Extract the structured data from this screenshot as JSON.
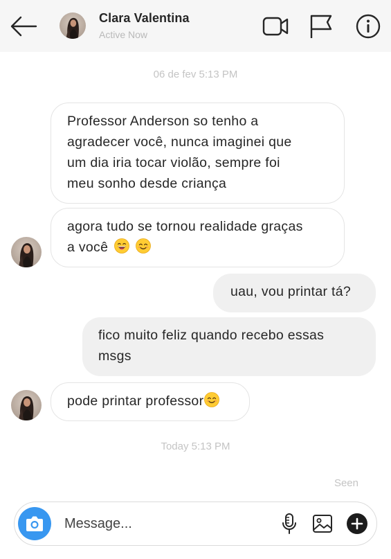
{
  "header": {
    "name": "Clara Valentina",
    "status": "Active Now",
    "icons": [
      "back-arrow-icon",
      "video-camera-icon",
      "flag-icon",
      "info-icon"
    ]
  },
  "messages": {
    "timestamp_1": "06 de fev 5:13 PM",
    "m1_lines": [
      "Professor Anderson so tenho a",
      "agradecer você, nunca imaginei que",
      "um dia iria tocar violão, sempre foi",
      "meu sonho desde criança"
    ],
    "m2_lines": [
      "agora tudo se tornou realidade graças",
      "a você"
    ],
    "m3_text": "uau, vou printar tá?",
    "m4_lines": [
      "fico muito feliz quando recebo essas",
      "msgs"
    ],
    "m5_text": "pode printar professor",
    "timestamp_2": "Today 5:13 PM",
    "seen": "Seen"
  },
  "composer": {
    "placeholder": "Message...",
    "icons": [
      "camera-icon",
      "microphone-icon",
      "gallery-icon",
      "plus-icon"
    ]
  },
  "colors": {
    "header_bg": "#f6f6f6",
    "outgoing_bubble": "#f0f0f0",
    "camera_button": "#3897f0",
    "muted_text": "#c4c4c4"
  }
}
